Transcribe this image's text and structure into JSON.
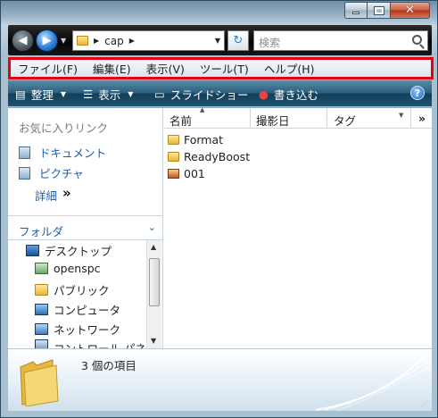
{
  "window": {
    "controls": {
      "minimize": "–",
      "maximize": "□",
      "close": "✕"
    }
  },
  "address": {
    "path": [
      "cap"
    ],
    "refresh_icon": "refresh-icon"
  },
  "search": {
    "placeholder": "検索"
  },
  "menu": [
    "ファイル(F)",
    "編集(E)",
    "表示(V)",
    "ツール(T)",
    "ヘルプ(H)"
  ],
  "commands": {
    "organize": "整理",
    "view": "表示",
    "slideshow": "スライドショー",
    "burn": "書き込む"
  },
  "navpane": {
    "favorites_header": "お気に入りリンク",
    "favorites": [
      "ドキュメント",
      "ピクチャ"
    ],
    "more": "詳細",
    "folders_label": "フォルダ",
    "tree": [
      "デスクトップ",
      "openspc",
      "パブリック",
      "コンピュータ",
      "ネットワーク",
      "コントロール パネ"
    ]
  },
  "filelist": {
    "columns": [
      "名前",
      "撮影日",
      "タグ"
    ],
    "more_columns": "»",
    "items": [
      {
        "name": "Format",
        "type": "folder"
      },
      {
        "name": "ReadyBoost",
        "type": "folder"
      },
      {
        "name": "001",
        "type": "image"
      }
    ]
  },
  "details": {
    "count": "3 個の項目"
  },
  "colors": {
    "highlight_border": "#e60012",
    "link": "#1a5fb4",
    "cmdbar": "#2a5f7e"
  }
}
